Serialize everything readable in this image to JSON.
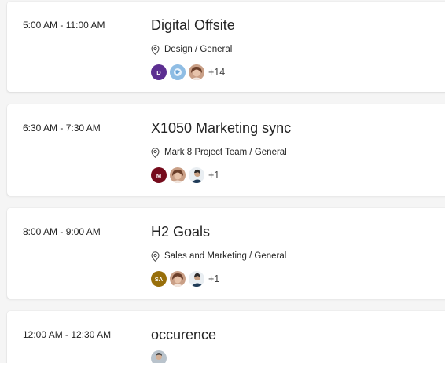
{
  "events": [
    {
      "time": "5:00 AM - 11:00 AM",
      "title": "Digital Offsite",
      "location": "Design / General",
      "attendees": [
        {
          "type": "initials",
          "initials": "D",
          "color": "#5c2e91"
        },
        {
          "type": "photo",
          "icon": "globe-avatar-photo"
        },
        {
          "type": "photo",
          "icon": "person-avatar-photo"
        }
      ],
      "more": "+14"
    },
    {
      "time": "6:30 AM - 7:30 AM",
      "title": "X1050 Marketing sync",
      "location": "Mark 8 Project Team / General",
      "attendees": [
        {
          "type": "initials",
          "initials": "M",
          "color": "#750b1c"
        },
        {
          "type": "photo",
          "icon": "person-avatar-photo"
        },
        {
          "type": "photo",
          "icon": "person-avatar-photo"
        }
      ],
      "more": "+1"
    },
    {
      "time": "8:00 AM - 9:00 AM",
      "title": "H2 Goals",
      "location": "Sales and Marketing / General",
      "attendees": [
        {
          "type": "initials",
          "initials": "SA",
          "color": "#986f0b"
        },
        {
          "type": "photo",
          "icon": "person-avatar-photo"
        },
        {
          "type": "photo",
          "icon": "person-avatar-photo"
        }
      ],
      "more": "+1"
    },
    {
      "time": "12:00 AM - 12:30 AM",
      "title": "occurence",
      "location": "",
      "attendees": [
        {
          "type": "photo",
          "icon": "person-avatar-photo"
        }
      ],
      "more": ""
    }
  ]
}
